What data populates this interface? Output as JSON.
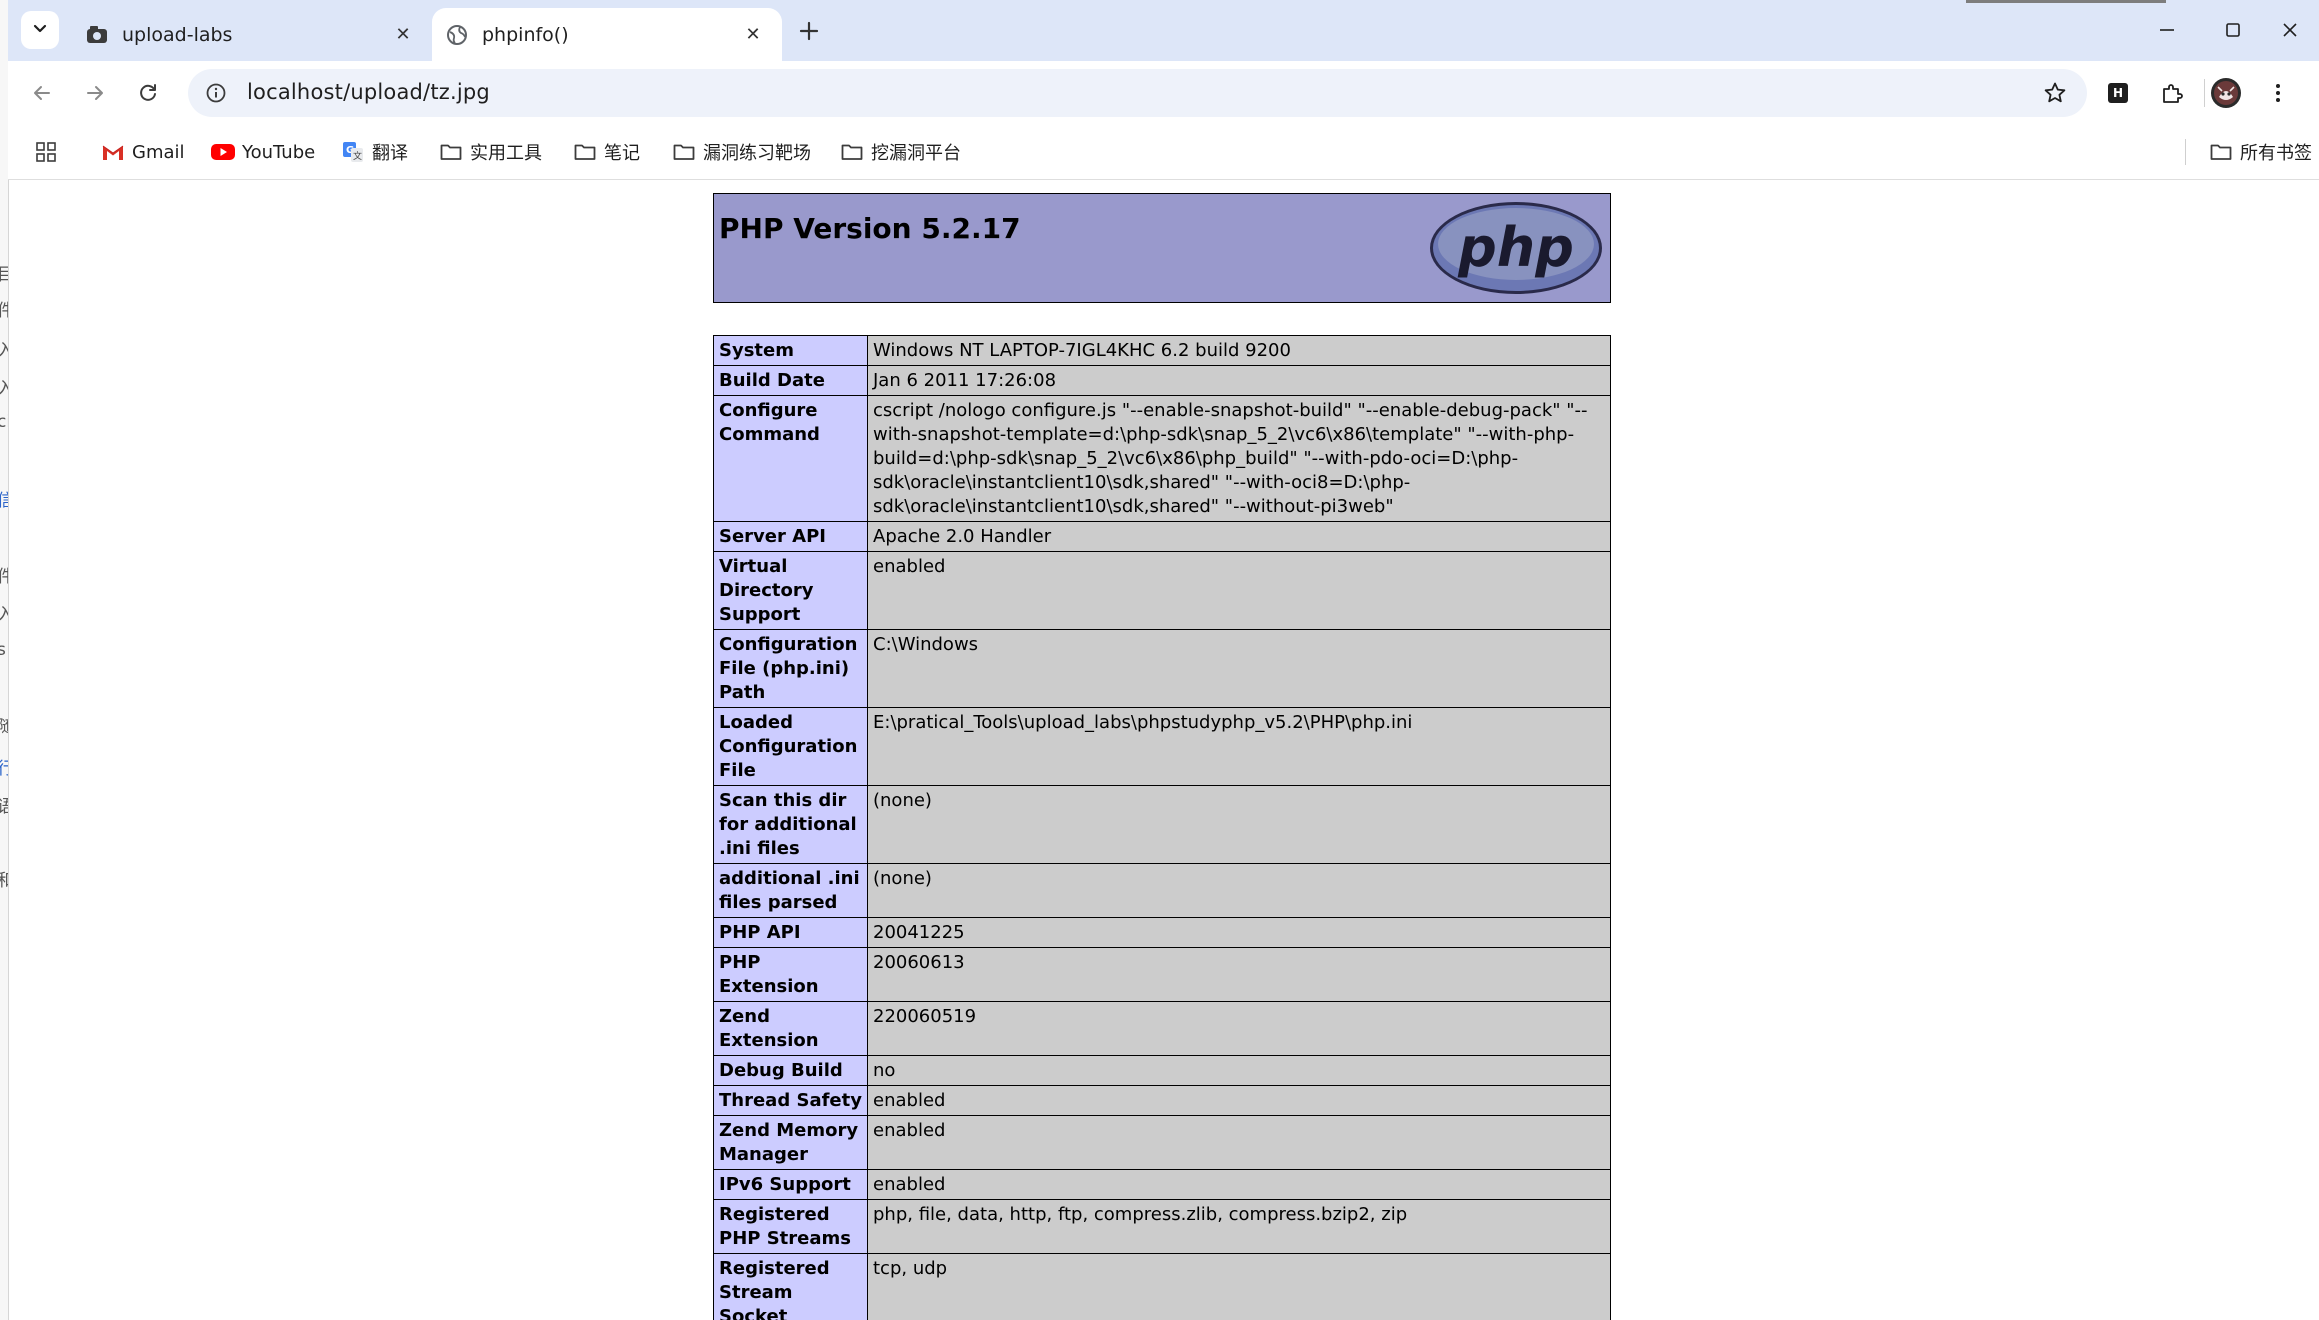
{
  "browser": {
    "tabs": [
      {
        "title": "upload-labs",
        "active": false
      },
      {
        "title": "phpinfo()",
        "active": true
      }
    ],
    "address": {
      "url": "localhost/upload/tz.jpg"
    },
    "bookmarks": [
      {
        "label": "Gmail",
        "icon": "gmail-icon"
      },
      {
        "label": "YouTube",
        "icon": "youtube-icon"
      },
      {
        "label": "翻译",
        "icon": "translate-icon"
      },
      {
        "label": "实用工具",
        "icon": "folder-icon"
      },
      {
        "label": "笔记",
        "icon": "folder-icon"
      },
      {
        "label": "漏洞练习靶场",
        "icon": "folder-icon"
      },
      {
        "label": "挖漏洞平台",
        "icon": "folder-icon"
      }
    ],
    "all_bookmarks_label": "所有书签",
    "extension_badge": "H"
  },
  "left_strip_glyphs": [
    "目",
    "件",
    "入",
    "入",
    "ci",
    "信",
    "件",
    "入",
    "s",
    "随",
    "行",
    "语",
    "和"
  ],
  "phpinfo": {
    "version_title": "PHP Version 5.2.17",
    "logo_text": "php",
    "rows": [
      {
        "key": "System",
        "value": "Windows NT LAPTOP-7IGL4KHC 6.2 build 9200"
      },
      {
        "key": "Build Date",
        "value": "Jan 6 2011 17:26:08"
      },
      {
        "key": "Configure Command",
        "value": "cscript /nologo configure.js \"--enable-snapshot-build\" \"--enable-debug-pack\" \"--with-snapshot-template=d:\\php-sdk\\snap_5_2\\vc6\\x86\\template\" \"--with-php-build=d:\\php-sdk\\snap_5_2\\vc6\\x86\\php_build\" \"--with-pdo-oci=D:\\php-sdk\\oracle\\instantclient10\\sdk,shared\" \"--with-oci8=D:\\php-sdk\\oracle\\instantclient10\\sdk,shared\" \"--without-pi3web\""
      },
      {
        "key": "Server API",
        "value": "Apache 2.0 Handler"
      },
      {
        "key": "Virtual Directory Support",
        "value": "enabled"
      },
      {
        "key": "Configuration File (php.ini) Path",
        "value": "C:\\Windows"
      },
      {
        "key": "Loaded Configuration File",
        "value": "E:\\pratical_Tools\\upload_labs\\phpstudyphp_v5.2\\PHP\\php.ini"
      },
      {
        "key": "Scan this dir for additional .ini files",
        "value": "(none)"
      },
      {
        "key": "additional .ini files parsed",
        "value": "(none)"
      },
      {
        "key": "PHP API",
        "value": "20041225"
      },
      {
        "key": "PHP Extension",
        "value": "20060613"
      },
      {
        "key": "Zend Extension",
        "value": "220060519"
      },
      {
        "key": "Debug Build",
        "value": "no"
      },
      {
        "key": "Thread Safety",
        "value": "enabled"
      },
      {
        "key": "Zend Memory Manager",
        "value": "enabled"
      },
      {
        "key": "IPv6 Support",
        "value": "enabled"
      },
      {
        "key": "Registered PHP Streams",
        "value": "php, file, data, http, ftp, compress.zlib, compress.bzip2, zip"
      },
      {
        "key": "Registered Stream Socket Transports",
        "value": "tcp, udp"
      }
    ]
  },
  "colors": {
    "header_bg": "#9999cc",
    "key_bg": "#ccccff",
    "value_bg": "#cccccc",
    "tabstrip_bg": "#dde6f8",
    "omnibox_bg": "#eef2fa"
  }
}
